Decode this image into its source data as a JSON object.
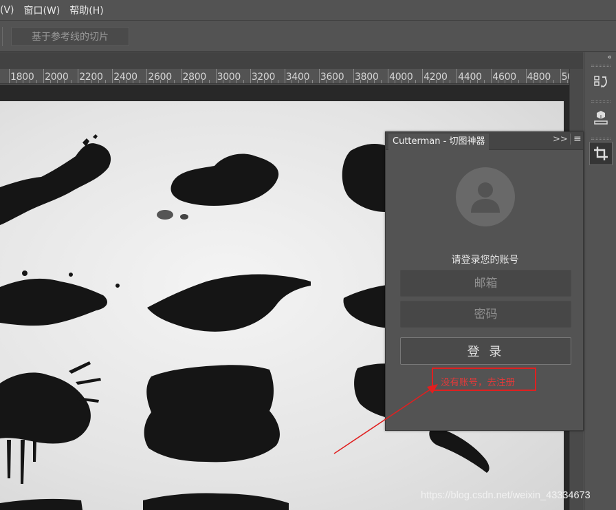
{
  "menubar": {
    "items": [
      "(V)",
      "窗口(W)",
      "帮助(H)"
    ]
  },
  "options": {
    "guide_slice_label": "基于参考线的切片"
  },
  "ruler": {
    "labels": [
      "1800",
      "2000",
      "2200",
      "2400",
      "2600",
      "2800",
      "3000",
      "3200",
      "3400",
      "3600",
      "3800",
      "4000",
      "4200",
      "4400",
      "4600",
      "4800",
      "50"
    ]
  },
  "dock": {
    "collapse_icon": "«",
    "buttons": [
      "history-icon",
      "3d-icon",
      "crop-icon"
    ]
  },
  "cutterman": {
    "tab_title": "Cutterman - 切图神器",
    "expand_icon": ">>",
    "menu_icon": "≡",
    "login_title": "请登录您的账号",
    "email_placeholder": "邮箱",
    "password_placeholder": "密码",
    "login_button": "登 录",
    "register_link": "没有账号，去注册"
  },
  "annotation": {
    "color": "#e02020"
  },
  "watermark": "https://blog.csdn.net/weixin_43334673"
}
